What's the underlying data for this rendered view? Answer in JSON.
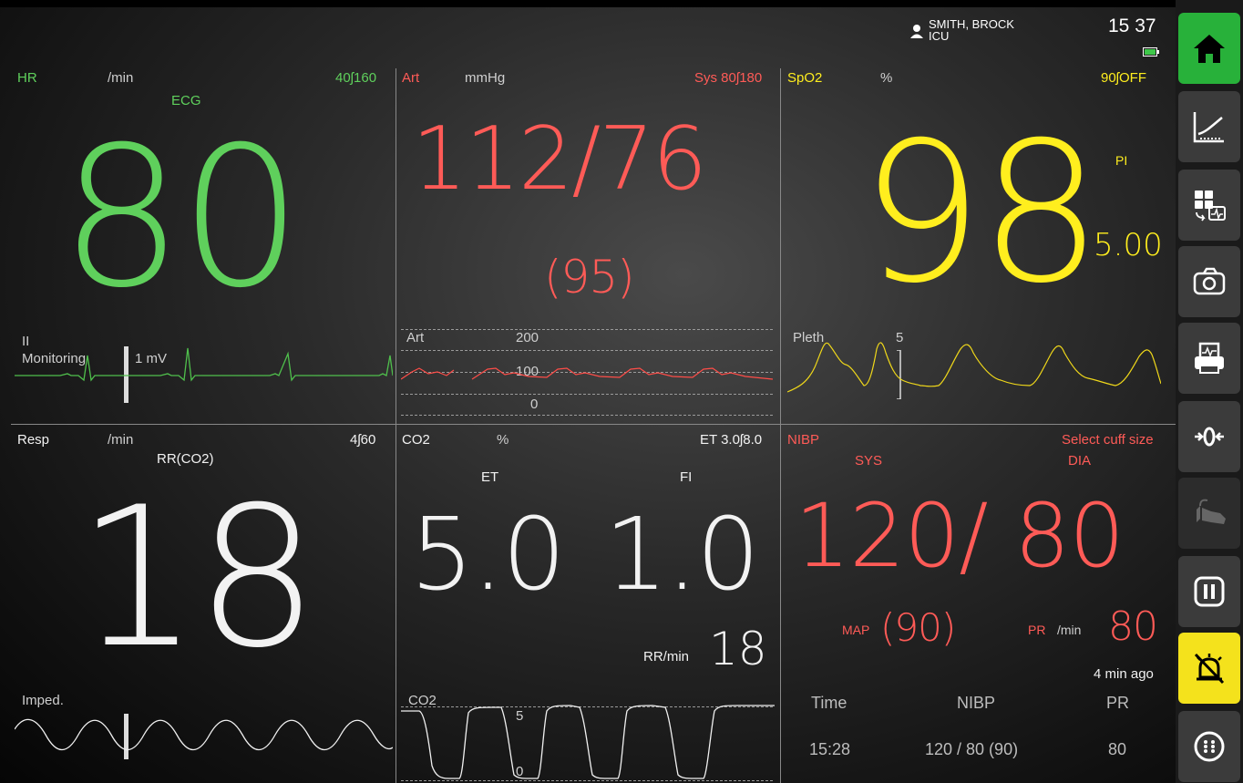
{
  "patient": {
    "name": "SMITH, BROCK",
    "unit": "ICU",
    "time": "15 37"
  },
  "hr": {
    "label": "HR",
    "unit": "/min",
    "limits": "40ʃ160",
    "source": "ECG",
    "value": "80"
  },
  "ecg": {
    "lead": "II",
    "mode": "Monitoring",
    "scale": "1 mV"
  },
  "art": {
    "label": "Art",
    "unit": "mmHg",
    "limits": "Sys 80ʃ180",
    "value": "112/76",
    "mean": "(95)",
    "wave_label": "Art",
    "scale_high": "200",
    "scale_mid": "100",
    "scale_low": "0"
  },
  "spo2": {
    "label": "SpO2",
    "unit": "%",
    "limits": "90ʃOFF",
    "value": "98",
    "pi_label": "PI",
    "pi_value": "5.00",
    "wave_label": "Pleth",
    "wave_scale": "5"
  },
  "resp": {
    "label": "Resp",
    "unit": "/min",
    "limits": "4ʃ60",
    "source": "RR(CO2)",
    "value": "18",
    "wave_label": "Imped."
  },
  "co2": {
    "label": "CO2",
    "unit": "%",
    "limits": "ET 3.0ʃ8.0",
    "et_label": "ET",
    "fi_label": "FI",
    "et_value": "5.0",
    "fi_value": "1.0",
    "rr_label": "RR/min",
    "rr_value": "18",
    "wave_label": "CO2",
    "scale_high": "5",
    "scale_low": "0"
  },
  "nibp": {
    "label": "NIBP",
    "cuff_msg": "Select cuff size",
    "sys_label": "SYS",
    "dia_label": "DIA",
    "value": "120/ 80",
    "map_label": "MAP",
    "map_value": "(90)",
    "pr_label": "PR",
    "pr_unit": "/min",
    "pr_value": "80",
    "age": "4 min ago",
    "table": {
      "headers": [
        "Time",
        "NIBP",
        "PR"
      ],
      "rows": [
        [
          "15:28",
          "120 / 80 (90)",
          "80"
        ]
      ]
    }
  },
  "sidebar": {
    "items": [
      "home-icon",
      "trends-icon",
      "monitor-layout-icon",
      "camera-icon",
      "printer-icon",
      "zero-icon",
      "nibp-cuff-icon",
      "pause-icon",
      "alarm-audio-off-icon",
      "more-icon"
    ]
  },
  "colors": {
    "hr": "#5fd05c",
    "art": "#ff5b57",
    "spo2": "#ffee1e",
    "resp": "#f2f2f2",
    "nibp": "#ff5b57",
    "active_button": "#28b13a",
    "alarm_button": "#f4e21c"
  }
}
